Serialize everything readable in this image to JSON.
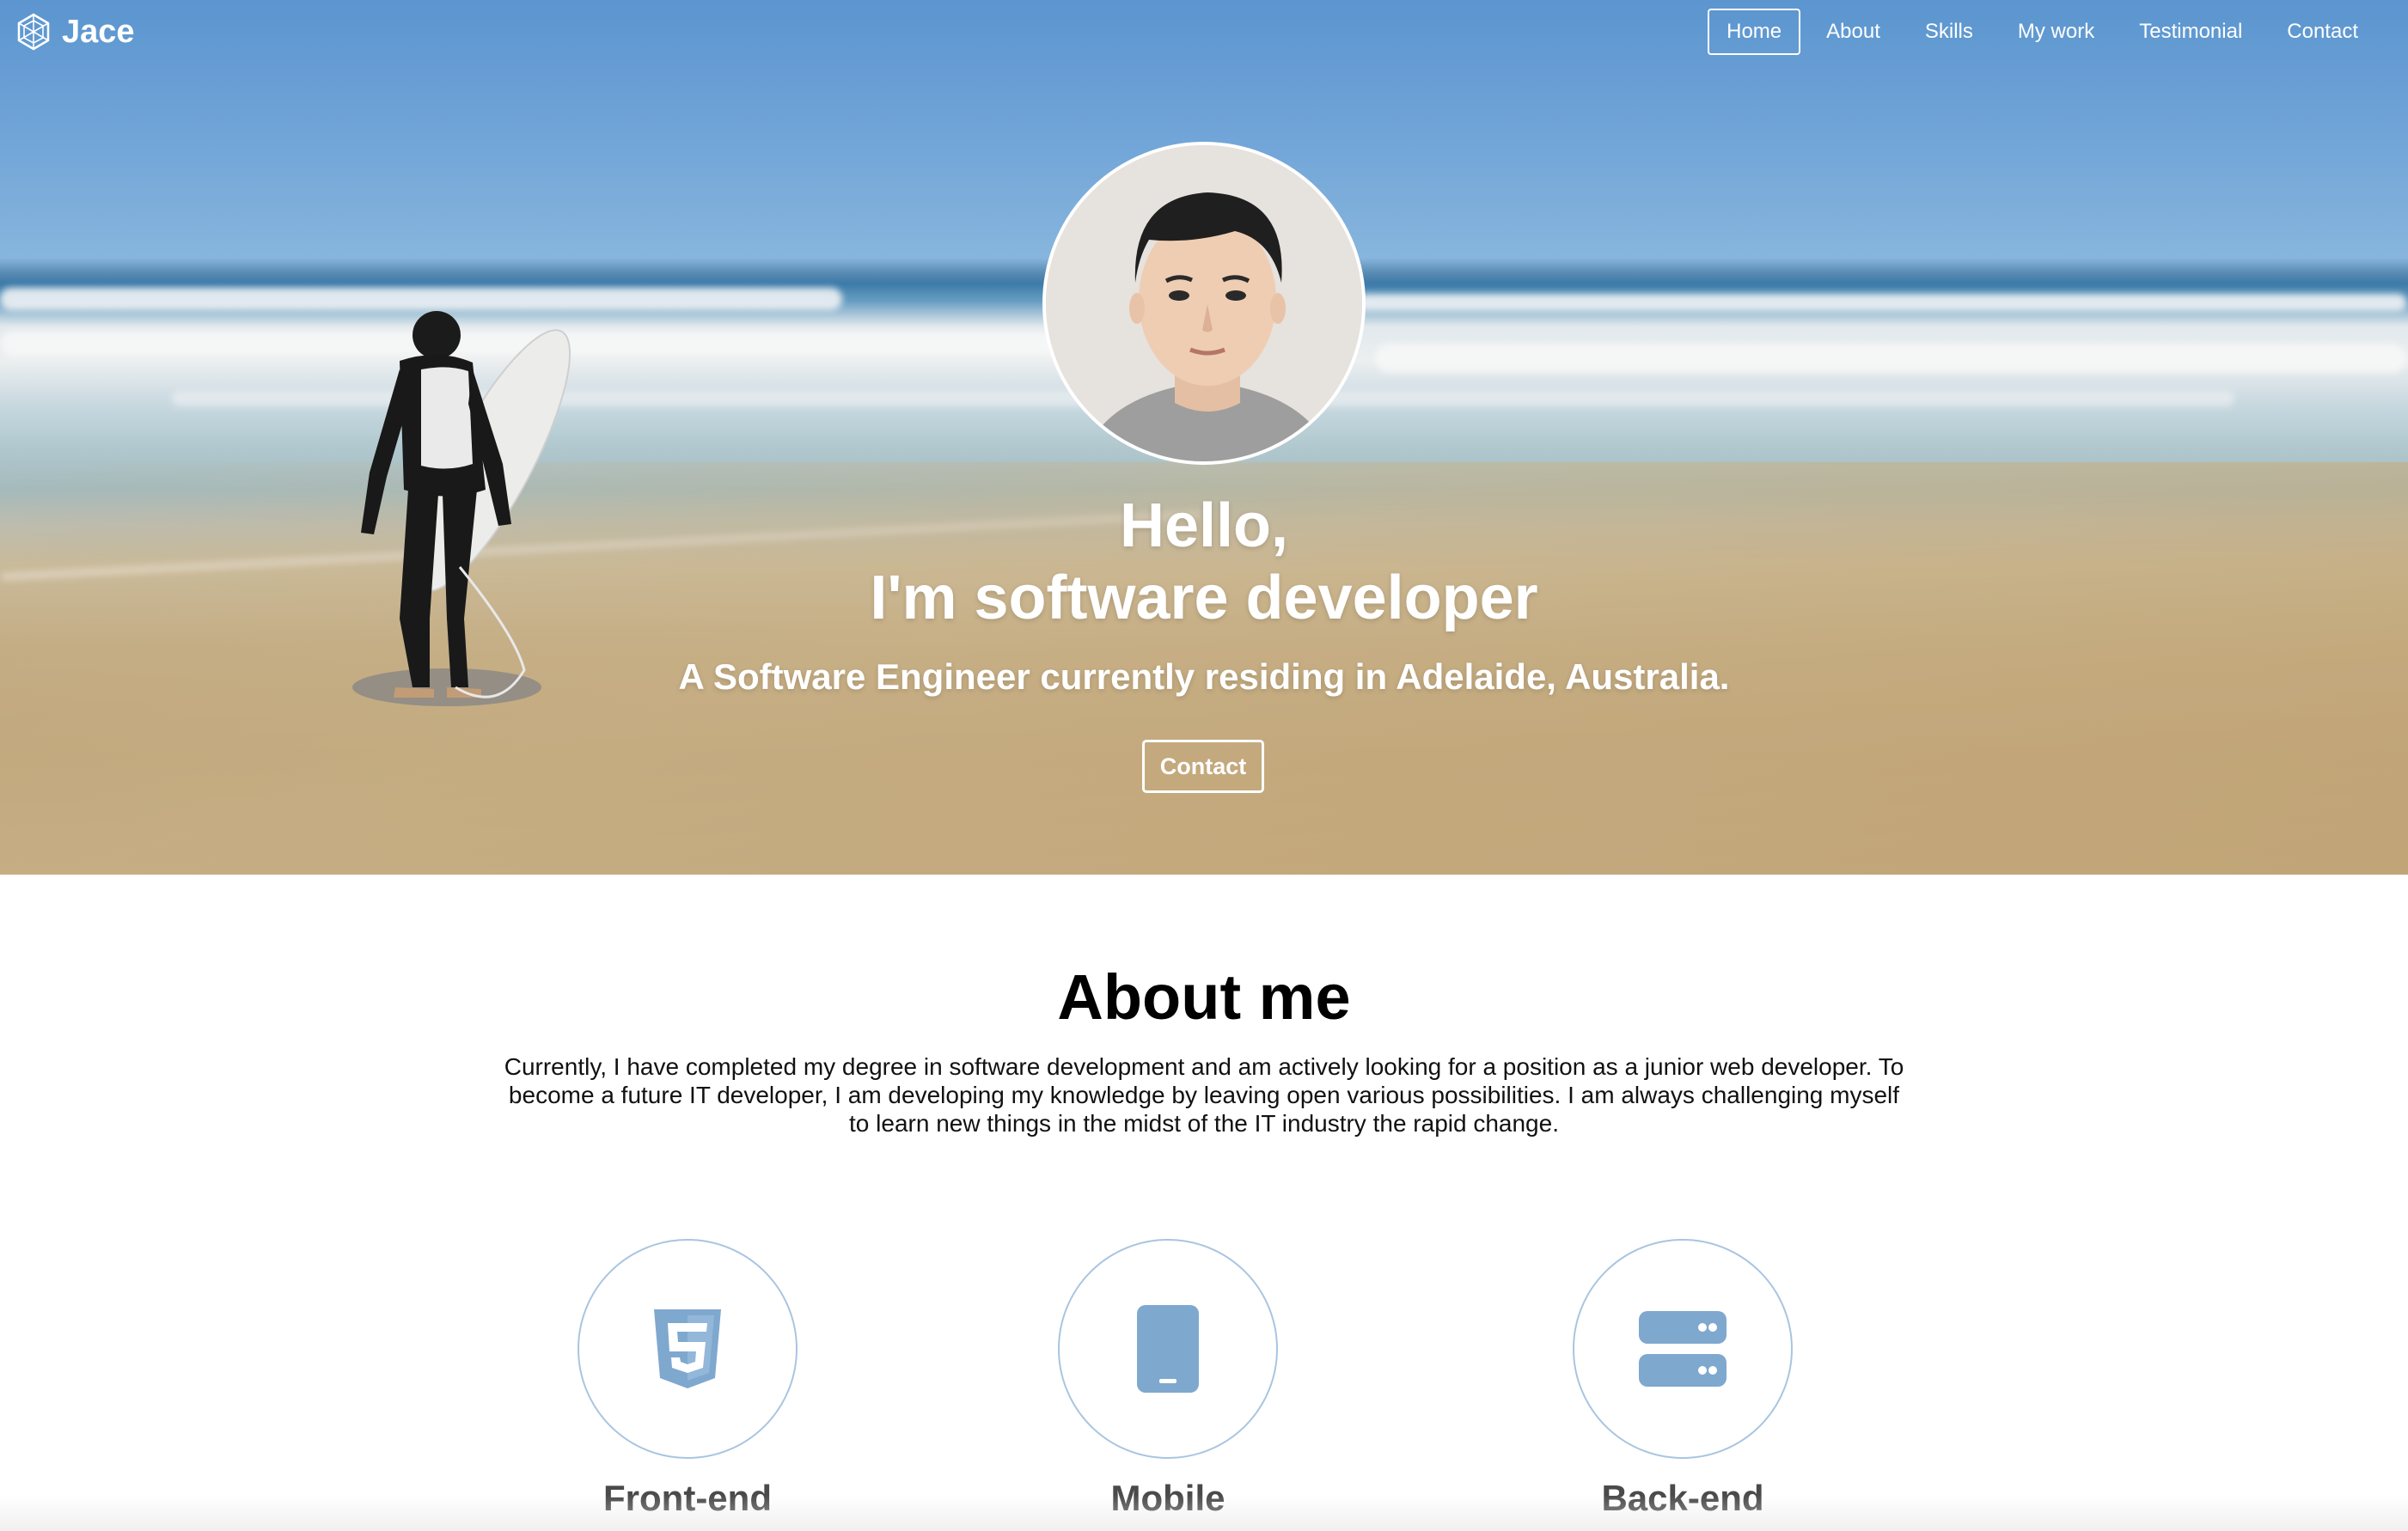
{
  "brand": {
    "name": "Jace",
    "logo_icon": "hexagon-logo-icon"
  },
  "nav": {
    "items": [
      {
        "label": "Home",
        "active": true
      },
      {
        "label": "About",
        "active": false
      },
      {
        "label": "Skills",
        "active": false
      },
      {
        "label": "My work",
        "active": false
      },
      {
        "label": "Testimonial",
        "active": false
      },
      {
        "label": "Contact",
        "active": false
      }
    ]
  },
  "hero": {
    "greeting_line1": "Hello,",
    "greeting_line2": "I'm software developer",
    "subtitle": "A Software Engineer currently residing in Adelaide, Australia.",
    "contact_button": "Contact"
  },
  "about": {
    "title": "About me",
    "text": "Currently, I have completed my degree in software development and am actively looking for a position as a junior web developer. To become a future IT developer, I am developing my knowledge by leaving open various possibilities. I am always challenging myself to learn new things in the midst of the IT industry the rapid change."
  },
  "skills": [
    {
      "label": "Front-end",
      "icon": "html5-icon"
    },
    {
      "label": "Mobile",
      "icon": "mobile-icon"
    },
    {
      "label": "Back-end",
      "icon": "server-icon"
    }
  ],
  "colors": {
    "accent": "#7fa8cf",
    "circle_border": "#a9c5e0",
    "heading": "#000000",
    "skill_label": "#4a4a4a",
    "hero_text": "#ffffff"
  }
}
